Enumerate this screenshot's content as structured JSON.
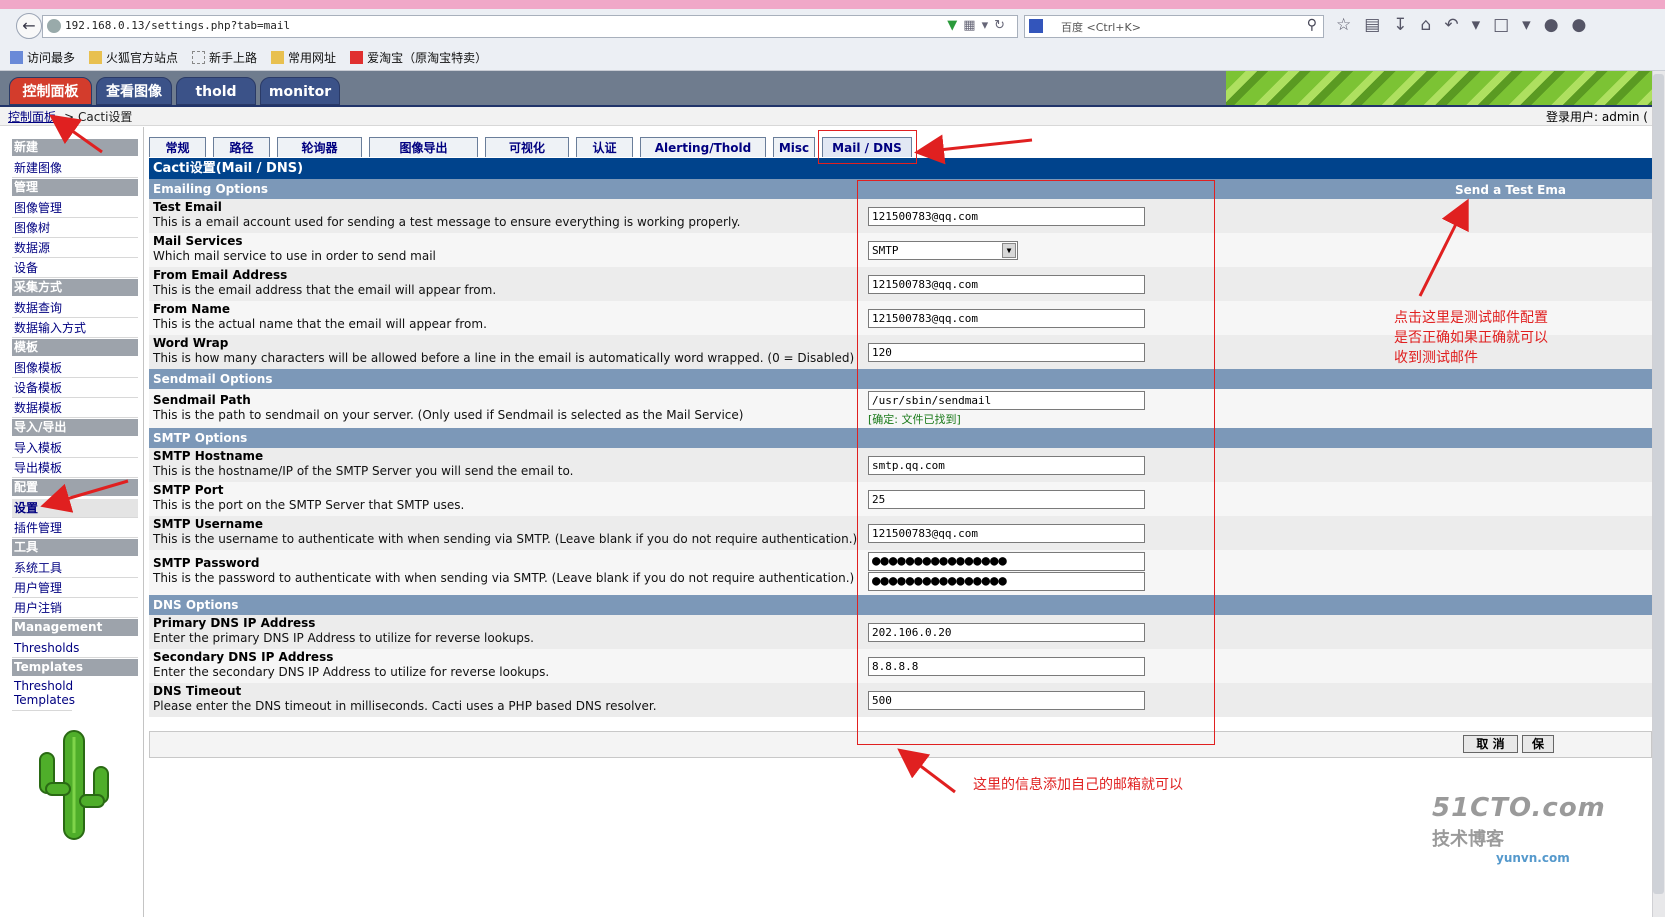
{
  "browser": {
    "url": "192.168.0.13/settings.php?tab=mail",
    "search_placeholder": "百度 <Ctrl+K>",
    "bookmarks": [
      "访问最多",
      "火狐官方站点",
      "新手上路",
      "常用网址",
      "爱淘宝（原淘宝特卖）"
    ]
  },
  "top_tabs": [
    "控制面板",
    "查看图像",
    "thold",
    "monitor"
  ],
  "breadcrumb": {
    "link": "控制面板",
    "rest": " -> Cacti设置"
  },
  "login_user": "登录用户: admin (",
  "sidebar": [
    {
      "type": "group",
      "label": "新建"
    },
    {
      "type": "item",
      "label": "新建图像"
    },
    {
      "type": "group",
      "label": "管理"
    },
    {
      "type": "item",
      "label": "图像管理"
    },
    {
      "type": "item",
      "label": "图像树"
    },
    {
      "type": "item",
      "label": "数据源"
    },
    {
      "type": "item",
      "label": "设备"
    },
    {
      "type": "group",
      "label": "采集方式"
    },
    {
      "type": "item",
      "label": "数据查询"
    },
    {
      "type": "item",
      "label": "数据输入方式"
    },
    {
      "type": "group",
      "label": "模板"
    },
    {
      "type": "item",
      "label": "图像模板"
    },
    {
      "type": "item",
      "label": "设备模板"
    },
    {
      "type": "item",
      "label": "数据模板"
    },
    {
      "type": "group",
      "label": "导入/导出"
    },
    {
      "type": "item",
      "label": "导入模板"
    },
    {
      "type": "item",
      "label": "导出模板"
    },
    {
      "type": "group",
      "label": "配置"
    },
    {
      "type": "item",
      "label": "设置",
      "active": true
    },
    {
      "type": "item",
      "label": "插件管理"
    },
    {
      "type": "group",
      "label": "工具"
    },
    {
      "type": "item",
      "label": "系统工具"
    },
    {
      "type": "item",
      "label": "用户管理"
    },
    {
      "type": "item",
      "label": "用户注销"
    },
    {
      "type": "group",
      "label": "Management"
    },
    {
      "type": "item",
      "label": "Thresholds"
    },
    {
      "type": "group",
      "label": "Templates"
    },
    {
      "type": "item",
      "label": "Threshold Templates"
    }
  ],
  "settings_tabs": [
    "常规",
    "路径",
    "轮询器",
    "图像导出",
    "可视化",
    "认证",
    "Alerting/Thold",
    "Misc",
    "Mail / DNS"
  ],
  "page_title": "Cacti设置(Mail / DNS)",
  "send_test_email": "Send a Test Ema",
  "sections": {
    "emailing": "Emailing Options",
    "sendmail": "Sendmail Options",
    "smtp": "SMTP Options",
    "dns": "DNS Options"
  },
  "fields": {
    "test_email": {
      "label": "Test Email",
      "desc": "This is a email account used for sending a test message to ensure everything is working properly.",
      "value": "121500783@qq.com"
    },
    "mail_services": {
      "label": "Mail Services",
      "desc": "Which mail service to use in order to send mail",
      "value": "SMTP"
    },
    "from_email": {
      "label": "From Email Address",
      "desc": "This is the email address that the email will appear from.",
      "value": "121500783@qq.com"
    },
    "from_name": {
      "label": "From Name",
      "desc": "This is the actual name that the email will appear from.",
      "value": "121500783@qq.com"
    },
    "word_wrap": {
      "label": "Word Wrap",
      "desc": "This is how many characters will be allowed before a line in the email is automatically word wrapped. (0 = Disabled)",
      "value": "120"
    },
    "sendmail_path": {
      "label": "Sendmail Path",
      "desc": "This is the path to sendmail on your server. (Only used if Sendmail is selected as the Mail Service)",
      "value": "/usr/sbin/sendmail",
      "status": "[确定: 文件已找到]"
    },
    "smtp_host": {
      "label": "SMTP Hostname",
      "desc": "This is the hostname/IP of the SMTP Server you will send the email to.",
      "value": "smtp.qq.com"
    },
    "smtp_port": {
      "label": "SMTP Port",
      "desc": "This is the port on the SMTP Server that SMTP uses.",
      "value": "25"
    },
    "smtp_user": {
      "label": "SMTP Username",
      "desc": "This is the username to authenticate with when sending via SMTP. (Leave blank if you do not require authentication.)",
      "value": "121500783@qq.com"
    },
    "smtp_pass": {
      "label": "SMTP Password",
      "desc": "This is the password to authenticate with when sending via SMTP. (Leave blank if you do not require authentication.)",
      "value": "●●●●●●●●●●●●●●●●",
      "confirm": "●●●●●●●●●●●●●●●●"
    },
    "dns_primary": {
      "label": "Primary DNS IP Address",
      "desc": "Enter the primary DNS IP Address to utilize for reverse lookups.",
      "value": "202.106.0.20"
    },
    "dns_secondary": {
      "label": "Secondary DNS IP Address",
      "desc": "Enter the secondary DNS IP Address to utilize for reverse lookups.",
      "value": "8.8.8.8"
    },
    "dns_timeout": {
      "label": "DNS Timeout",
      "desc": "Please enter the DNS timeout in milliseconds. Cacti uses a PHP based DNS resolver.",
      "value": "500"
    }
  },
  "buttons": {
    "cancel": "取 消",
    "save": "保"
  },
  "annotations": {
    "note_right": [
      "点击这里是测试邮件配置",
      "是否正确如果正确就可以",
      "收到测试邮件"
    ],
    "note_bottom": "这里的信息添加自己的邮箱就可以"
  },
  "watermark": {
    "line1": "51CTO.com",
    "line2": "技术博客",
    "line3": "yunvn.com"
  },
  "colors": {
    "accent_red": "#e02020",
    "title_bar": "#00438c",
    "section_bar": "#7c98b8",
    "nav_link": "#000080"
  }
}
